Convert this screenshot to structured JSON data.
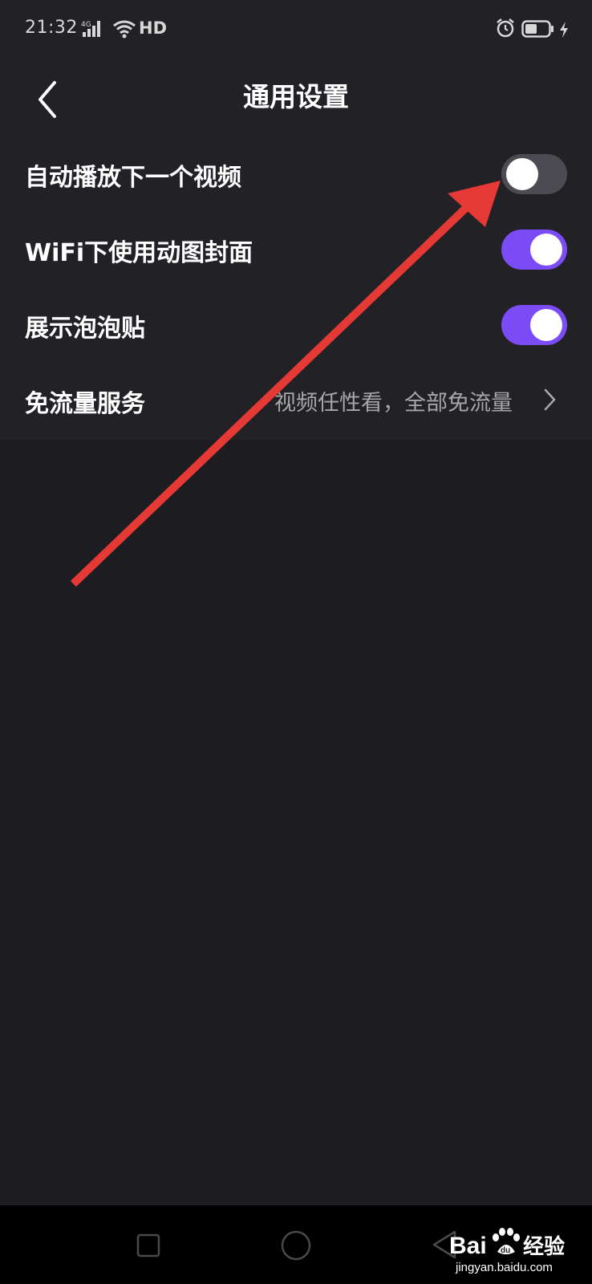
{
  "status_bar": {
    "time": "21:32",
    "network": "4G",
    "hd": "HD"
  },
  "header": {
    "title": "通用设置"
  },
  "settings": [
    {
      "label": "自动播放下一个视频",
      "type": "toggle",
      "on": false
    },
    {
      "label": "WiFi下使用动图封面",
      "type": "toggle",
      "on": true
    },
    {
      "label": "展示泡泡贴",
      "type": "toggle",
      "on": true
    },
    {
      "label": "免流量服务",
      "type": "link",
      "value": "视频任性看，全部免流量"
    }
  ],
  "watermark": {
    "brand": "Baidu经验",
    "domain": "jingyan.baidu.com"
  },
  "colors": {
    "background": "#1d1c20",
    "panel": "#222126",
    "accent": "#7b4cf6",
    "toggle_off": "#4c4b51",
    "annotation": "#e53935"
  }
}
